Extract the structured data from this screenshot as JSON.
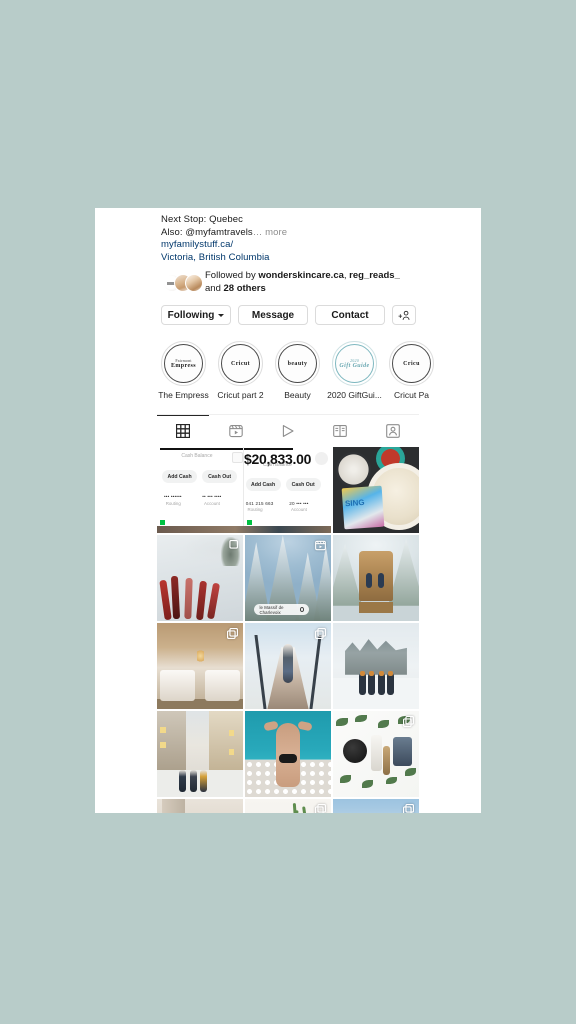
{
  "background_color": "#b8ccc9",
  "app": "instagram-profile",
  "profile": {
    "bio": [
      {
        "text": "Next Stop: Quebec",
        "style": "plain"
      },
      {
        "text": "Also: @myfamtravels",
        "more": "… more",
        "style": "plain"
      },
      {
        "text": "myfamilystuff.ca/",
        "style": "link"
      },
      {
        "text": "Victoria, British Columbia",
        "style": "link"
      }
    ],
    "bio_line_1": "Next Stop: Quebec",
    "bio_line_2": "Also: @myfamtravels",
    "bio_more": "… more",
    "website": "myfamilystuff.ca/",
    "location": "Victoria, British Columbia",
    "followed_by": {
      "prefix": "Followed by ",
      "name_1": "wonderskincare.ca",
      "separator": ", ",
      "name_2": "reg_reads_",
      "suffix_prefix": "and ",
      "others": "28 others"
    }
  },
  "actions": {
    "following_label": "Following",
    "message_label": "Message",
    "contact_label": "Contact",
    "add_user_label": "+"
  },
  "highlights": [
    {
      "label": "The Empress",
      "cover_line_1": "Fairmont",
      "cover_line_2": "Empress",
      "accent": "#4a4a4a"
    },
    {
      "label": "Cricut part 2",
      "cover_line_1": "",
      "cover_line_2": "Cricut",
      "accent": "#4a4a4a"
    },
    {
      "label": "Beauty",
      "cover_line_1": "",
      "cover_line_2": "beauty",
      "accent": "#4a4a4a"
    },
    {
      "label": "2020 GiftGui...",
      "cover_line_1": "2020",
      "cover_line_2": "Gift Guide",
      "accent": "#7fb8c0"
    },
    {
      "label": "Cricut Pa",
      "cover_line_1": "",
      "cover_line_2": "Cricu",
      "accent": "#4a4a4a"
    }
  ],
  "tabs": [
    {
      "name": "grid-tab",
      "icon": "grid-icon",
      "active": true
    },
    {
      "name": "reels-tab",
      "icon": "reels-icon",
      "active": false
    },
    {
      "name": "igtv-tab",
      "icon": "play-icon",
      "active": false
    },
    {
      "name": "guides-tab",
      "icon": "book-icon",
      "active": false
    },
    {
      "name": "tagged-tab",
      "icon": "tagged-person-icon",
      "active": false
    }
  ],
  "grid": {
    "rows": [
      [
        {
          "name": "post-cashapp-balance",
          "art": "a-cashapp",
          "badge": "none",
          "alt": "Cash App balance screenshot"
        },
        {
          "name": "post-cashapp-detail",
          "art": "a-cashapp2",
          "badge": "none",
          "alt": "Cash App account detail"
        },
        {
          "name": "post-movie-night-snacks",
          "art": "a-food",
          "badge": "none",
          "alt": "Popcorn, candy and Sing 2 DVD"
        }
      ],
      [
        {
          "name": "post-skis-on-snow",
          "art": "a-ski",
          "badge": "carousel",
          "alt": "Skis laid out on snow"
        },
        {
          "name": "post-snowy-trees",
          "art": "a-trees",
          "badge": "reels",
          "alt": "Snow covered evergreen trees"
        },
        {
          "name": "post-giant-chair",
          "art": "a-chair",
          "badge": "none",
          "alt": "Giant wooden chair in snow"
        }
      ],
      [
        {
          "name": "post-hotel-room",
          "art": "a-hotel",
          "badge": "carousel",
          "alt": "Hotel room with two beds"
        },
        {
          "name": "post-snowy-bridge",
          "art": "a-bridge",
          "badge": "carousel",
          "alt": "Person on snowy boardwalk bridge"
        },
        {
          "name": "post-chateau-frontenac",
          "art": "a-castle",
          "badge": "none",
          "alt": "Family in front of Chateau Frontenac"
        }
      ],
      [
        {
          "name": "post-old-quebec-street",
          "art": "a-street",
          "badge": "none",
          "alt": "Family on snowy old Quebec street"
        },
        {
          "name": "post-poolside",
          "art": "a-pool",
          "badge": "none",
          "alt": "Person lying by a turquoise pool"
        },
        {
          "name": "post-beauty-flatlay",
          "art": "a-beauty",
          "badge": "carousel",
          "alt": "Beauty products flatlay with leaves"
        }
      ],
      [
        {
          "name": "post-portrait",
          "art": "a-portrait",
          "badge": "none",
          "alt": "Portrait in doorway"
        },
        {
          "name": "post-plant-pot",
          "art": "a-plant",
          "badge": "carousel",
          "alt": "White pot with green plant"
        },
        {
          "name": "post-cyclist",
          "art": "a-cyclist",
          "badge": "carousel",
          "alt": "Person in black jacket outdoors"
        }
      ]
    ]
  },
  "cashapp": {
    "cash_balance_label": "Cash Balance",
    "amount": "$20,833.00",
    "amount_sublabel": "Cash Balance",
    "add_cash_label": "Add Cash",
    "cash_out_label": "Cash Out",
    "routing_label": "Routing",
    "account_label": "Account",
    "routing_value_left": "••• ••••••",
    "account_value_left": "•• ••• ••••",
    "routing_value_right": "041 215 663",
    "account_value_right": "20 ••• •••"
  },
  "food_post": {
    "dvd_title": "SING"
  },
  "map_pill": {
    "text": "le Massif de Charlevoix"
  }
}
